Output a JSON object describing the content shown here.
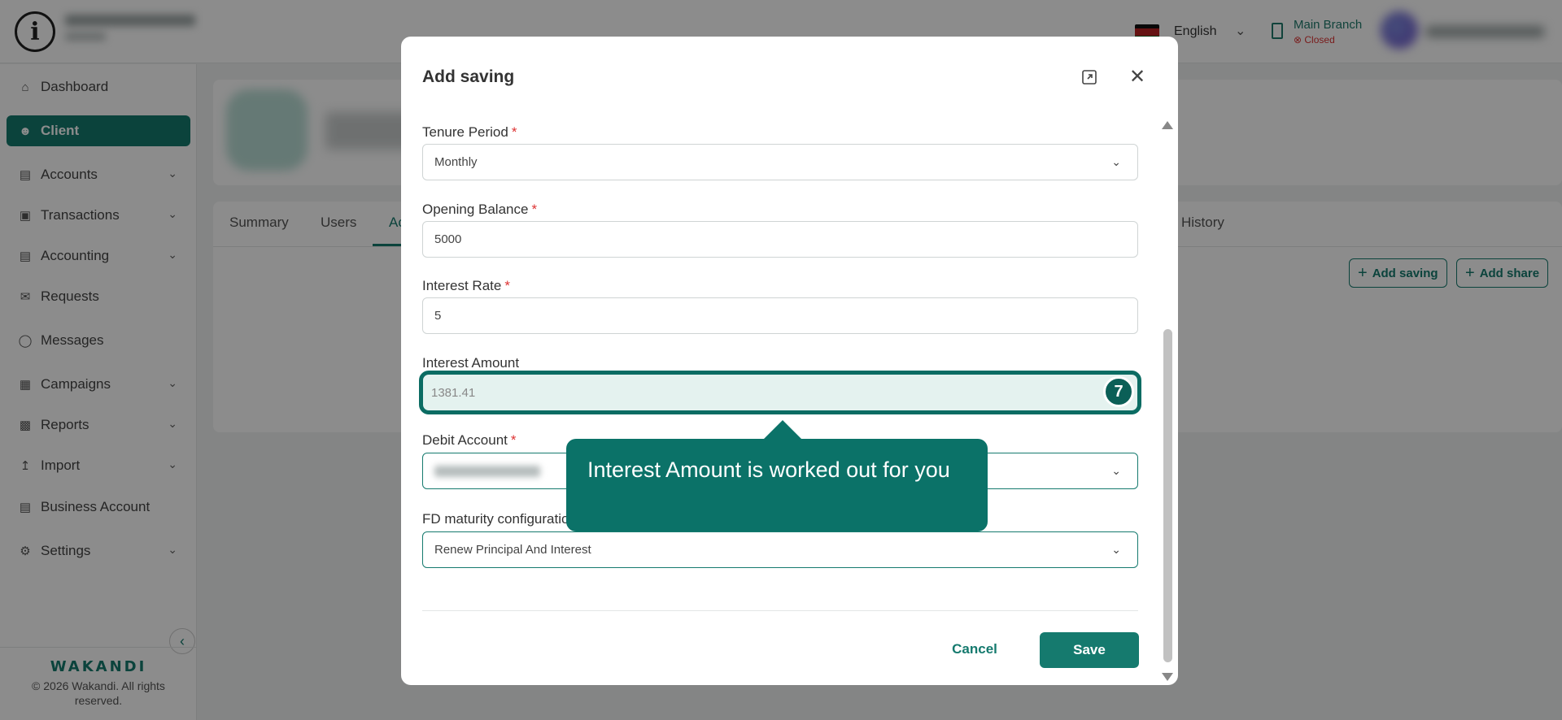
{
  "topbar": {
    "language": "English",
    "branch_name": "Main Branch",
    "branch_status": "Closed",
    "status_color": "#d33333",
    "accent_color": "#157a6e"
  },
  "sidebar": {
    "items": [
      {
        "label": "Dashboard",
        "icon": "home-icon"
      },
      {
        "label": "Client",
        "icon": "users-icon",
        "active": true
      },
      {
        "label": "Accounts",
        "icon": "wallet-icon"
      },
      {
        "label": "Transactions",
        "icon": "cash-icon"
      },
      {
        "label": "Accounting",
        "icon": "ledger-icon"
      },
      {
        "label": "Requests",
        "icon": "mail-icon"
      },
      {
        "label": "Messages",
        "icon": "chat-icon"
      },
      {
        "label": "Campaigns",
        "icon": "grid-icon"
      },
      {
        "label": "Reports",
        "icon": "bar-chart-icon"
      },
      {
        "label": "Import",
        "icon": "upload-icon"
      },
      {
        "label": "Business Account",
        "icon": "briefcase-icon"
      },
      {
        "label": "Settings",
        "icon": "gear-icon"
      }
    ],
    "brand": "WAKANDI",
    "copyright": "© 2026 Wakandi. All rights reserved."
  },
  "main": {
    "tabs": [
      "Summary",
      "Users",
      "Ac",
      "History"
    ],
    "buttons": {
      "add_saving": "Add saving",
      "add_share": "Add share"
    }
  },
  "modal": {
    "title": "Add saving",
    "fields": {
      "tenure_period": {
        "label": "Tenure Period",
        "value": "Monthly"
      },
      "opening_balance": {
        "label": "Opening Balance",
        "value": "5000"
      },
      "interest_rate": {
        "label": "Interest Rate",
        "value": "5"
      },
      "interest_amount": {
        "label": "Interest Amount",
        "value": "1381.41"
      },
      "debit_account": {
        "label": "Debit Account"
      },
      "fd_maturity": {
        "label": "FD maturity configuratio",
        "value": "Renew Principal And Interest"
      }
    },
    "required_mark": "*",
    "step_number": "7",
    "tooltip": "Interest Amount is worked out for you",
    "cancel_label": "Cancel",
    "save_label": "Save"
  }
}
